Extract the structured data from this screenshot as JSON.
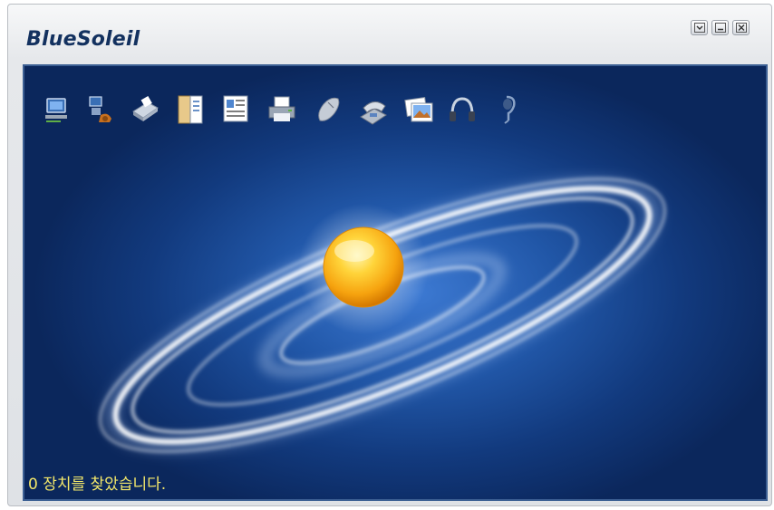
{
  "app": {
    "logo_text": "BlueSoleil"
  },
  "window_controls": [
    {
      "name": "options-button",
      "icon": "chevron-down-icon"
    },
    {
      "name": "minimize-button",
      "icon": "minimize-icon"
    },
    {
      "name": "close-button",
      "icon": "close-icon"
    }
  ],
  "toolbar": {
    "services": [
      {
        "name": "network-access-service",
        "icon": "network-computer-icon"
      },
      {
        "name": "dial-up-networking-service",
        "icon": "dial-up-modem-icon"
      },
      {
        "name": "fax-service",
        "icon": "fax-icon"
      },
      {
        "name": "file-transfer-service",
        "icon": "file-transfer-icon"
      },
      {
        "name": "pim-synchronization-service",
        "icon": "pim-sync-icon"
      },
      {
        "name": "printer-service",
        "icon": "printer-icon"
      },
      {
        "name": "mouse-hid-service",
        "icon": "mouse-icon"
      },
      {
        "name": "phone-service",
        "icon": "phone-icon"
      },
      {
        "name": "image-transfer-service",
        "icon": "image-icon"
      },
      {
        "name": "headphone-service",
        "icon": "headphone-icon"
      },
      {
        "name": "headset-service",
        "icon": "headset-icon"
      }
    ]
  },
  "status": {
    "text": "0 장치를 찾았습니다."
  },
  "colors": {
    "status_text": "#f4e86a",
    "background_center": "#3d7ad3",
    "background_edge": "#0b275c",
    "sun": "#f8b320"
  }
}
